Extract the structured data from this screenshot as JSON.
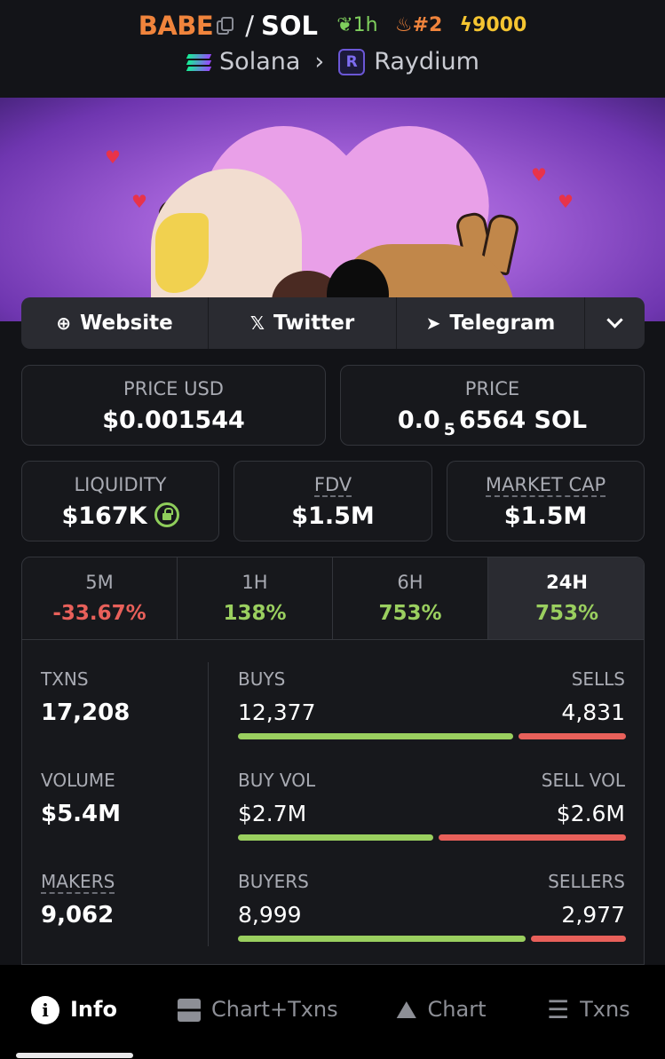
{
  "header": {
    "token": "BABE",
    "separator": "/",
    "quote": "SOL",
    "age": "1h",
    "rank": "#2",
    "boost": "9000",
    "chain": "Solana",
    "dex": "Raydium",
    "dex_logo_letter": "R"
  },
  "links": {
    "website": "Website",
    "twitter": "Twitter",
    "telegram": "Telegram"
  },
  "price": {
    "usd_label": "PRICE USD",
    "usd_value": "$0.001544",
    "native_label": "PRICE",
    "native_prefix": "0.0",
    "native_zeros": "5",
    "native_rest": "6564 SOL"
  },
  "metrics": {
    "liquidity_label": "LIQUIDITY",
    "liquidity_value": "$167K",
    "fdv_label": "FDV",
    "fdv_value": "$1.5M",
    "mcap_label": "MARKET CAP",
    "mcap_value": "$1.5M"
  },
  "timeframes": [
    {
      "label": "5M",
      "change": "-33.67%"
    },
    {
      "label": "1H",
      "change": "138%"
    },
    {
      "label": "6H",
      "change": "753%"
    },
    {
      "label": "24H",
      "change": "753%"
    }
  ],
  "stats": {
    "txns_label": "TXNS",
    "txns_value": "17,208",
    "buys_label": "BUYS",
    "buys_value": "12,377",
    "sells_label": "SELLS",
    "sells_value": "4,831",
    "volume_label": "VOLUME",
    "volume_value": "$5.4M",
    "buy_vol_label": "BUY VOL",
    "buy_vol_value": "$2.7M",
    "sell_vol_label": "SELL VOL",
    "sell_vol_value": "$2.6M",
    "makers_label": "MAKERS",
    "makers_value": "9,062",
    "buyers_label": "BUYERS",
    "buyers_value": "8,999",
    "sellers_label": "SELLERS",
    "sellers_value": "2,977"
  },
  "nav": {
    "info": "Info",
    "chart_txns": "Chart+Txns",
    "chart": "Chart",
    "txns": "Txns"
  },
  "colors": {
    "positive": "#9acf5f",
    "negative": "#e8605a",
    "token_accent": "#f0843c"
  }
}
